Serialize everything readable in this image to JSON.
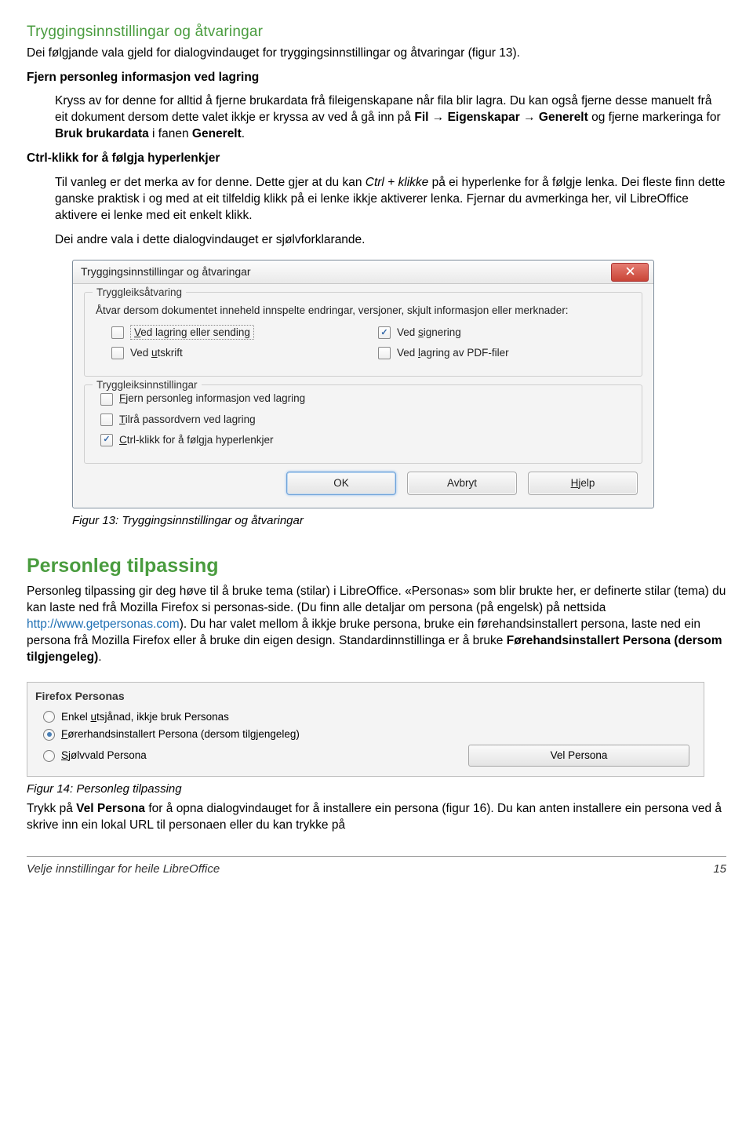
{
  "section1": {
    "heading": "Tryggingsinnstillingar og åtvaringar",
    "intro": "Dei følgjande vala gjeld for dialogvindauget for tryggingsinnstillingar og åtvaringar (figur 13).",
    "sub1_title": "Fjern personleg informasjon ved lagring",
    "sub1_body_a": "Kryss av for denne for alltid å fjerne brukardata frå fileigenskapane når fila blir lagra. Du kan også fjerne desse manuelt frå eit dokument dersom dette valet ikkje er kryssa av ved å gå inn på ",
    "sub1_body_b_bold1": "Fil",
    "sub1_body_arrow": " → ",
    "sub1_body_b_bold2": "Eigenskapar",
    "sub1_body_b_bold3": "Generelt",
    "sub1_body_c": " og fjerne markeringa for ",
    "sub1_body_b_bold4": "Bruk brukardata",
    "sub1_body_d": " i fanen ",
    "sub1_body_b_bold5": "Generelt",
    "sub1_body_e": ".",
    "sub2_title": "Ctrl-klikk for å følgja hyperlenkjer",
    "sub2_body_a": "Til vanleg er det merka av for denne. Dette gjer at du kan ",
    "sub2_body_italic": "Ctrl + klikke",
    "sub2_body_b": " på ei hyperlenke for å følgje lenka. Dei fleste finn dette ganske praktisk i og med at eit tilfeldig klikk på ei lenke ikkje aktiverer lenka. Fjernar du avmerkinga her, vil LibreOffice aktivere ei lenke med eit enkelt klikk.",
    "sub3_body": "Dei andre vala i dette dialogvindauget er sjølvforklarande."
  },
  "dialog1": {
    "title": "Tryggingsinnstillingar og åtvaringar",
    "group1_label": "Tryggleiksåtvaring",
    "group1_text": "Åtvar dersom dokumentet inneheld innspelte endringar, versjoner, skjult informasjon eller merknader:",
    "cb1": "ed lagring eller sending",
    "cb1_u": "V",
    "cb2": "Ved ",
    "cb2_u": "s",
    "cb2_b": "ignering",
    "cb3": "Ved ",
    "cb3_u": "u",
    "cb3_b": "tskrift",
    "cb4": "Ved ",
    "cb4_u": "l",
    "cb4_b": "agring av PDF-filer",
    "group2_label": "Tryggleiksinnstillingar",
    "cb5_u": "F",
    "cb5": "jern personleg informasjon ved lagring",
    "cb6_u": "T",
    "cb6": "ilrå passordvern ved lagring",
    "cb7_u": "C",
    "cb7": "trl-klikk for å følgja hyperlenkjer",
    "btn_ok": "OK",
    "btn_cancel": "Avbryt",
    "btn_help_u": "H",
    "btn_help": "jelp"
  },
  "caption1": "Figur 13: Tryggingsinnstillingar og åtvaringar",
  "section2": {
    "heading": "Personleg tilpassing",
    "body_a": "Personleg tilpassing gir deg høve til å bruke tema (stilar) i LibreOffice. «Personas» som blir brukte her, er definerte stilar (tema) du kan laste ned frå Mozilla Firefox si personas-side. (Du finn alle detaljar om persona (på engelsk) på nettsida ",
    "link": "http://www.getpersonas.com",
    "body_b": "). Du har valet mellom å ikkje bruke persona, bruke ein førehandsinstallert persona, laste ned ein persona frå Mozilla Firefox eller å bruke din eigen design. Standardinnstillinga er å bruke ",
    "body_bold": "Førehandsinstallert Persona (dersom tilgjengeleg)",
    "body_c": "."
  },
  "dialog2": {
    "title": "Firefox Personas",
    "r1_a": "Enkel ",
    "r1_u": "u",
    "r1_b": "tsjånad, ikkje bruk Personas",
    "r2_u": "F",
    "r2": "ørerhandsinstallert Persona (dersom tilgjengeleg)",
    "r3_u": "S",
    "r3": "jølvvald Persona",
    "btn": "Vel Persona"
  },
  "caption2": "Figur 14: Personleg tilpassing",
  "section3": {
    "body_a": "Trykk på ",
    "body_bold": "Vel Persona",
    "body_b": " for å opna dialogvindauget for å installere ein persona (figur 16). Du kan anten installere ein persona ved å skrive inn ein lokal URL til personaen eller du kan trykke på"
  },
  "footer": {
    "left": "Velje  innstillingar for heile LibreOffice",
    "right": "15"
  }
}
